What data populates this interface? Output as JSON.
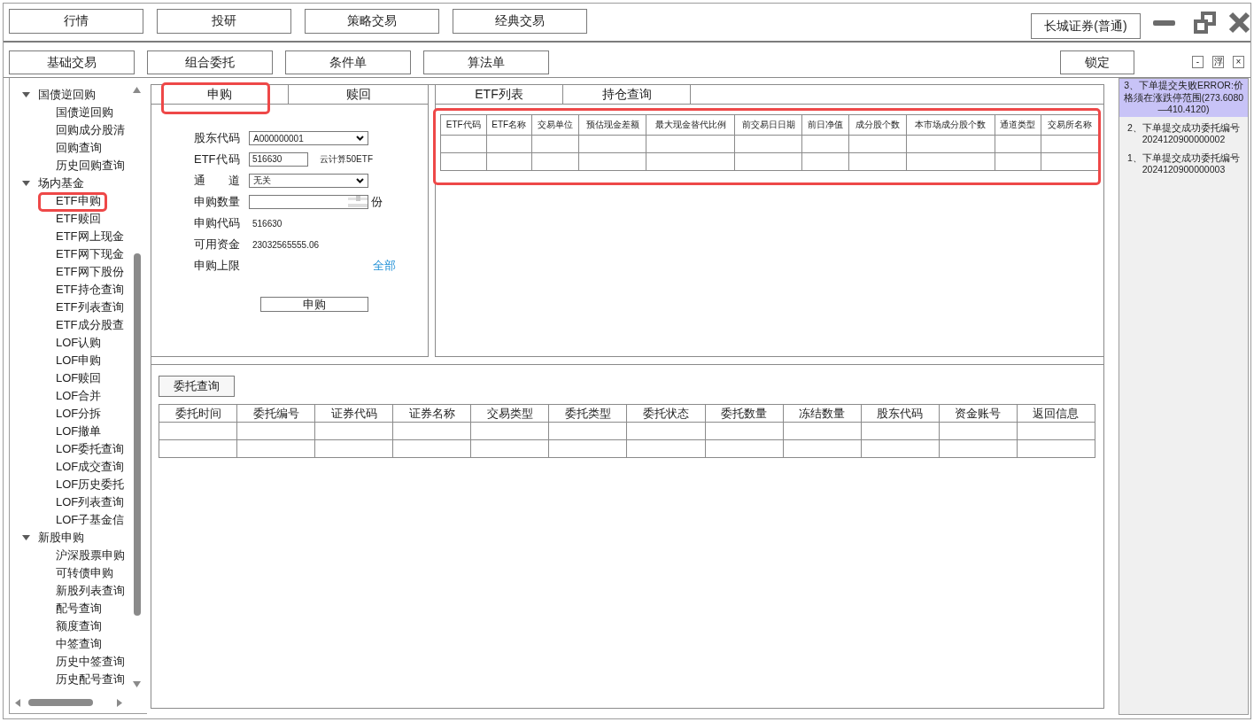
{
  "top_nav": {
    "tabs": [
      {
        "label": "行情"
      },
      {
        "label": "投研"
      },
      {
        "label": "策略交易"
      },
      {
        "label": "经典交易"
      }
    ],
    "account": "长城证券(普通)"
  },
  "toolbar": {
    "buttons": [
      "基础交易",
      "组合委托",
      "条件单",
      "算法单"
    ],
    "lock_button": "锁定",
    "panel_controls": [
      "-",
      "浮",
      "×"
    ]
  },
  "sidebar": {
    "groups": [
      {
        "label": "国债逆回购",
        "expanded": true,
        "children": [
          {
            "label": "国债逆回购",
            "highlighted": false
          },
          {
            "label": "回购成分股清",
            "highlighted": false
          },
          {
            "label": "回购查询",
            "highlighted": false
          },
          {
            "label": "历史回购查询",
            "highlighted": false
          }
        ]
      },
      {
        "label": "场内基金",
        "expanded": true,
        "children": [
          {
            "label": "ETF申购",
            "highlighted": true
          },
          {
            "label": "ETF赎回",
            "highlighted": false
          },
          {
            "label": "ETF网上现金",
            "highlighted": false
          },
          {
            "label": "ETF网下现金",
            "highlighted": false
          },
          {
            "label": "ETF网下股份",
            "highlighted": false
          },
          {
            "label": "ETF持仓查询",
            "highlighted": false
          },
          {
            "label": "ETF列表查询",
            "highlighted": false
          },
          {
            "label": "ETF成分股查",
            "highlighted": false
          },
          {
            "label": "LOF认购",
            "highlighted": false
          },
          {
            "label": "LOF申购",
            "highlighted": false
          },
          {
            "label": "LOF赎回",
            "highlighted": false
          },
          {
            "label": "LOF合并",
            "highlighted": false
          },
          {
            "label": "LOF分拆",
            "highlighted": false
          },
          {
            "label": "LOF撤单",
            "highlighted": false
          },
          {
            "label": "LOF委托查询",
            "highlighted": false
          },
          {
            "label": "LOF成交查询",
            "highlighted": false
          },
          {
            "label": "LOF历史委托",
            "highlighted": false
          },
          {
            "label": "LOF列表查询",
            "highlighted": false
          },
          {
            "label": "LOF子基金信",
            "highlighted": false
          }
        ]
      },
      {
        "label": "新股申购",
        "expanded": true,
        "children": [
          {
            "label": "沪深股票申购",
            "highlighted": false
          },
          {
            "label": "可转债申购",
            "highlighted": false
          },
          {
            "label": "新股列表查询",
            "highlighted": false
          },
          {
            "label": "配号查询",
            "highlighted": false
          },
          {
            "label": "额度查询",
            "highlighted": false
          },
          {
            "label": "中签查询",
            "highlighted": false
          },
          {
            "label": "历史中签查询",
            "highlighted": false
          },
          {
            "label": "历史配号查询",
            "highlighted": false
          }
        ]
      }
    ]
  },
  "subscription_form": {
    "tabs": [
      {
        "label": "申购",
        "highlighted": true
      },
      {
        "label": "赎回",
        "highlighted": false
      }
    ],
    "fields": [
      {
        "kind": "select",
        "label": "股东代码",
        "value": "A000000001"
      },
      {
        "kind": "input",
        "label": "ETF代码",
        "value": "516630",
        "note": "云计算50ETF"
      },
      {
        "kind": "select",
        "label": "通 道",
        "value": "无关"
      },
      {
        "kind": "spinner",
        "label": "申购数量",
        "unit": "份"
      },
      {
        "kind": "value",
        "label": "申购代码",
        "value": "516630"
      },
      {
        "kind": "value",
        "label": "可用资金",
        "value": "23032565555.06"
      },
      {
        "kind": "value",
        "label": "申购上限",
        "link": "全部"
      }
    ],
    "submit_button": "申购"
  },
  "etf_panel": {
    "tabs": [
      {
        "label": "ETF列表"
      },
      {
        "label": "持仓查询"
      }
    ],
    "table": {
      "highlighted": true,
      "columns": [
        "ETF代码",
        "ETF名称",
        "交易单位",
        "预估现金差额",
        "最大现金替代比例",
        "前交易日日期",
        "前日净值",
        "成分股个数",
        "本市场成分股个数",
        "通道类型",
        "交易所名称"
      ]
    }
  },
  "orders_panel": {
    "query_button": "委托查询",
    "table": {
      "columns": [
        "委托时间",
        "委托编号",
        "证券代码",
        "证券名称",
        "交易类型",
        "委托类型",
        "委托状态",
        "委托数量",
        "冻结数量",
        "股东代码",
        "资金账号",
        "返回信息"
      ]
    }
  },
  "messages": [
    {
      "text": "3、下单提交失败ERROR:价格须在涨跌停范围(273.6080—410.4120)",
      "selected": true
    },
    {
      "text": "2、下单提交成功委托编号2024120900000002",
      "selected": false
    },
    {
      "text": "1、下单提交成功委托编号2024120900000003",
      "selected": false
    }
  ]
}
